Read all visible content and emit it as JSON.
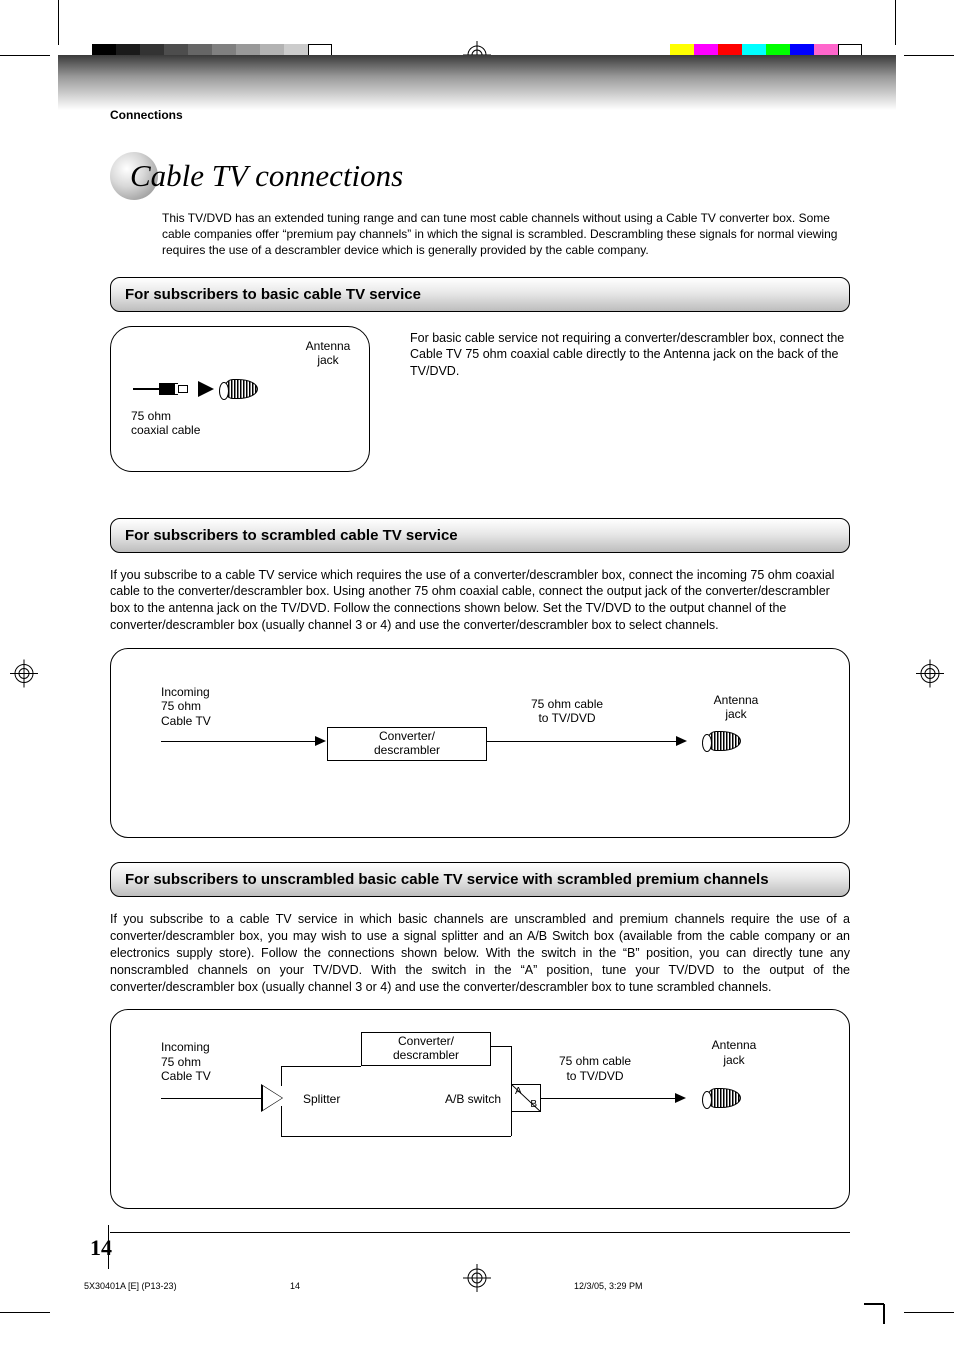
{
  "header": {
    "section_label": "Connections"
  },
  "title": "Cable TV connections",
  "intro": "This TV/DVD has an extended tuning range and can tune most cable channels without using a Cable TV converter box. Some cable companies offer “premium pay channels” in which the signal is scrambled. Descrambling these signals for normal viewing requires the use of a descrambler device which is generally provided by the cable company.",
  "section1": {
    "heading": "For subscribers to basic cable TV service",
    "text": "For basic cable service not requiring a converter/descrambler box, connect the Cable TV 75 ohm coaxial cable directly to the Antenna jack on the back of the TV/DVD.",
    "labels": {
      "antenna_jack": "Antenna\njack",
      "coax": "75 ohm\ncoaxial cable"
    }
  },
  "section2": {
    "heading": "For subscribers to scrambled cable TV service",
    "text": "If you subscribe to a cable TV service which requires the use of a converter/descrambler box, connect the incoming 75 ohm coaxial cable to the converter/descrambler box. Using another 75 ohm coaxial cable, connect the output jack of the converter/descrambler box to the antenna jack on the TV/DVD. Follow the connections shown below. Set the TV/DVD to the output channel of the converter/descrambler box (usually channel 3 or 4) and use the converter/descrambler box to select channels.",
    "labels": {
      "incoming": "Incoming\n75 ohm\nCable TV",
      "converter": "Converter/\ndescrambler",
      "cable_to_tv": "75 ohm cable\nto TV/DVD",
      "antenna_jack": "Antenna\njack"
    }
  },
  "section3": {
    "heading": "For subscribers to unscrambled basic cable TV service with scrambled premium channels",
    "text": "If you subscribe to a cable TV service in which basic channels are unscrambled and premium channels require the use of a converter/descrambler box, you may wish to use a signal splitter and an A/B Switch box (available from the cable company or an electronics supply store). Follow the connections shown below. With the switch in the “B” position, you can directly tune any nonscrambled channels on your TV/DVD. With the switch in the “A” position, tune your TV/DVD to the output of the converter/descrambler box (usually channel 3 or 4) and use the converter/descrambler box to tune scrambled channels.",
    "labels": {
      "incoming": "Incoming\n75 ohm\nCable TV",
      "converter": "Converter/\ndescrambler",
      "splitter": "Splitter",
      "ab_switch": "A/B switch",
      "a": "A",
      "b": "B",
      "cable_to_tv": "75 ohm cable\nto TV/DVD",
      "antenna_jack": "Antenna\njack"
    }
  },
  "page_number": "14",
  "footer": {
    "left": "5X30401A [E] (P13-23)",
    "center": "14",
    "right": "12/3/05, 3:29 PM"
  },
  "marks": {
    "grayscale": [
      "#000000",
      "#1a1a1a",
      "#333333",
      "#4d4d4d",
      "#666666",
      "#808080",
      "#999999",
      "#b3b3b3",
      "#cccccc",
      "#ffffff"
    ],
    "colors": [
      "#ffff00",
      "#ff00ff",
      "#ff0000",
      "#00ffff",
      "#00ff00",
      "#0000ff",
      "#ff66cc",
      "#ffffff"
    ]
  }
}
